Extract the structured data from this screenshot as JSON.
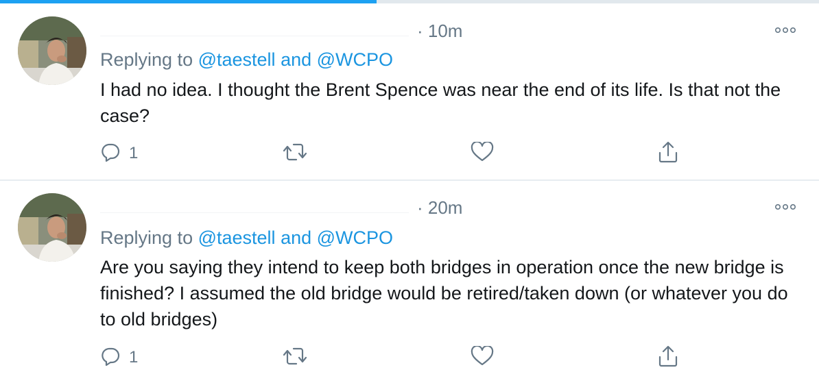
{
  "progress": {
    "value_fraction": 0.46
  },
  "tweets": [
    {
      "time": "· 10m",
      "reply_prefix": "Replying to ",
      "mention_1": "@taestell",
      "joiner": " and ",
      "mention_2": "@WCPO",
      "text": "I had no idea. I thought the Brent Spence was near the end of its life. Is that not the case?",
      "reply_count": "1"
    },
    {
      "time": "· 20m",
      "reply_prefix": "Replying to ",
      "mention_1": "@taestell",
      "joiner": " and ",
      "mention_2": "@WCPO",
      "text": "Are you saying they intend to keep both bridges in operation once the new bridge is finished? I assumed the old bridge would be retired/taken down (or whatever you do to old bridges)",
      "reply_count": "1"
    }
  ],
  "colors": {
    "accent": "#1da1f2",
    "link": "#1b95e0",
    "muted": "#657786",
    "text": "#14171a"
  },
  "icons": [
    "reply-icon",
    "retweet-icon",
    "like-icon",
    "share-icon",
    "more-icon"
  ]
}
